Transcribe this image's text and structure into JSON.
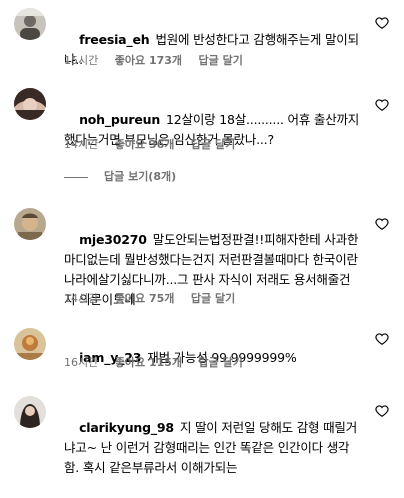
{
  "comments": [
    {
      "username": "freesia_eh",
      "text": "법원에 반성한다고 감행해주는게 말이되냐..",
      "time": "15시간",
      "likes": "좋아요 173개",
      "reply": "답글 달기"
    },
    {
      "username": "noh_pureun",
      "text": "12살이랑 18살.......... 어휴 출산까지 했다는거면 부모님은 임신한거 몰랐나...?",
      "time": "14시간",
      "likes": "좋아요 36개",
      "reply": "답글 달기"
    },
    {
      "username": "mje30270",
      "text": "말도안되는법정판결!!피해자한테 사과한마디없는데 뭘반성했다는건지 저런판결볼때마다 한국이란 나라에살기싫다니까...그 판사 자식이 저래도 용서해줄건지 의문이드네",
      "time": "14시간",
      "likes": "좋아요 75개",
      "reply": "답글 달기"
    },
    {
      "username": "iam_y_23",
      "text": "재범 가능성 99.9999999%",
      "time": "16시간",
      "likes": "좋아요 115개",
      "reply": "답글 달기"
    },
    {
      "username": "clarikyung_98",
      "text": "지 딸이 저런일 당해도 감형 때릴거냐고~ 난 이런거 감형때리는 인간 똑같은 인간이다 생각함. 혹시 같은부류라서 이해가되는",
      "time": "",
      "likes": "",
      "reply": ""
    }
  ],
  "view_replies": "답글 보기(8개)",
  "icons": {
    "like": "heart-icon"
  },
  "colors": {
    "meta": "#737373",
    "text": "#000000"
  }
}
